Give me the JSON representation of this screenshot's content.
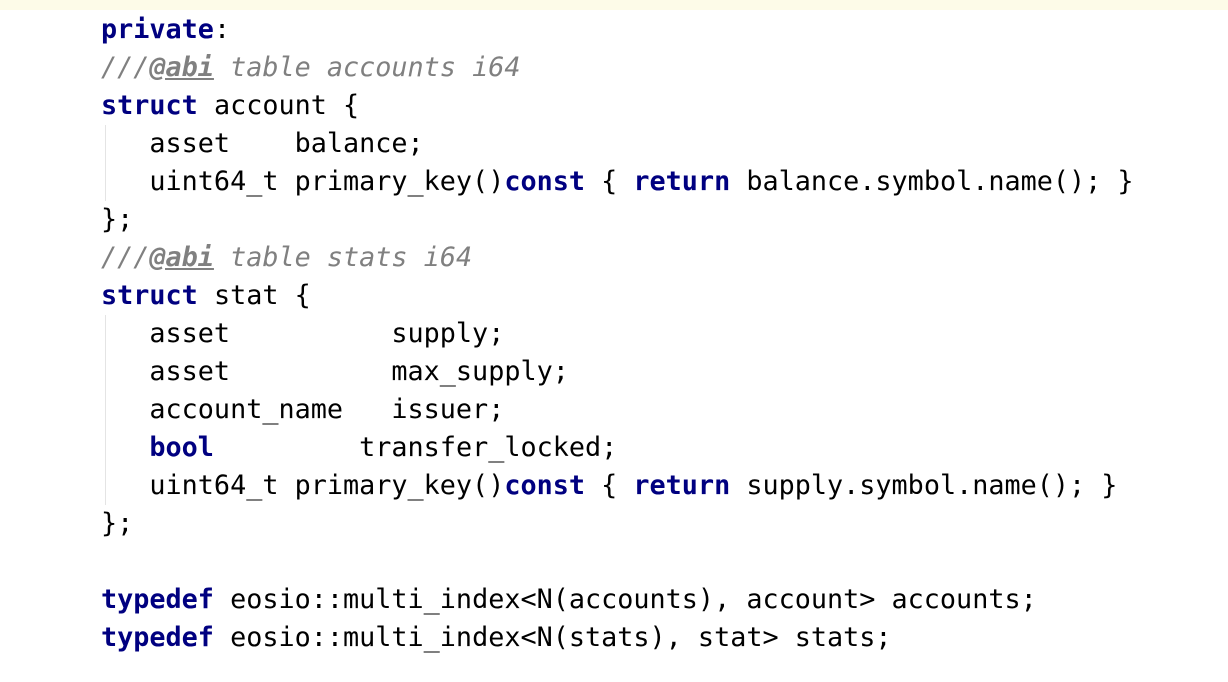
{
  "code_lines": [
    [
      {
        "t": "kw",
        "v": "private"
      },
      {
        "t": "tx",
        "v": ":"
      }
    ],
    [
      {
        "t": "cm",
        "v": "///"
      },
      {
        "t": "tag",
        "v": "@abi"
      },
      {
        "t": "cm",
        "v": " table accounts i64"
      }
    ],
    [
      {
        "t": "kw",
        "v": "struct"
      },
      {
        "t": "tx",
        "v": " account {"
      }
    ],
    [
      {
        "t": "tx",
        "v": "   asset    balance;"
      }
    ],
    [
      {
        "t": "tx",
        "v": "   uint64_t primary_key()"
      },
      {
        "t": "kw",
        "v": "const"
      },
      {
        "t": "tx",
        "v": " { "
      },
      {
        "t": "kw",
        "v": "return"
      },
      {
        "t": "tx",
        "v": " balance.symbol.name(); }"
      }
    ],
    [
      {
        "t": "tx",
        "v": "};"
      }
    ],
    [
      {
        "t": "cm",
        "v": "///"
      },
      {
        "t": "tag",
        "v": "@abi"
      },
      {
        "t": "cm",
        "v": " table stats i64"
      }
    ],
    [
      {
        "t": "kw",
        "v": "struct"
      },
      {
        "t": "tx",
        "v": " stat {"
      }
    ],
    [
      {
        "t": "tx",
        "v": "   asset          supply;"
      }
    ],
    [
      {
        "t": "tx",
        "v": "   asset          max_supply;"
      }
    ],
    [
      {
        "t": "tx",
        "v": "   account_name   issuer;"
      }
    ],
    [
      {
        "t": "tx",
        "v": "   "
      },
      {
        "t": "kw",
        "v": "bool"
      },
      {
        "t": "tx",
        "v": "         transfer_locked;"
      }
    ],
    [
      {
        "t": "tx",
        "v": "   uint64_t primary_key()"
      },
      {
        "t": "kw",
        "v": "const"
      },
      {
        "t": "tx",
        "v": " { "
      },
      {
        "t": "kw",
        "v": "return"
      },
      {
        "t": "tx",
        "v": " supply.symbol.name(); }"
      }
    ],
    [
      {
        "t": "tx",
        "v": "};"
      }
    ],
    [],
    [
      {
        "t": "kw",
        "v": "typedef"
      },
      {
        "t": "tx",
        "v": " eosio::multi_index<N(accounts), account> accounts;"
      }
    ],
    [
      {
        "t": "kw",
        "v": "typedef"
      },
      {
        "t": "tx",
        "v": " eosio::multi_index<N(stats), stat> stats;"
      }
    ]
  ],
  "colors": {
    "keyword": "#000080",
    "comment": "#808080",
    "text": "#000000",
    "current_line_background": "#fdfbe8",
    "indent_guide": "#e4e4e4"
  }
}
